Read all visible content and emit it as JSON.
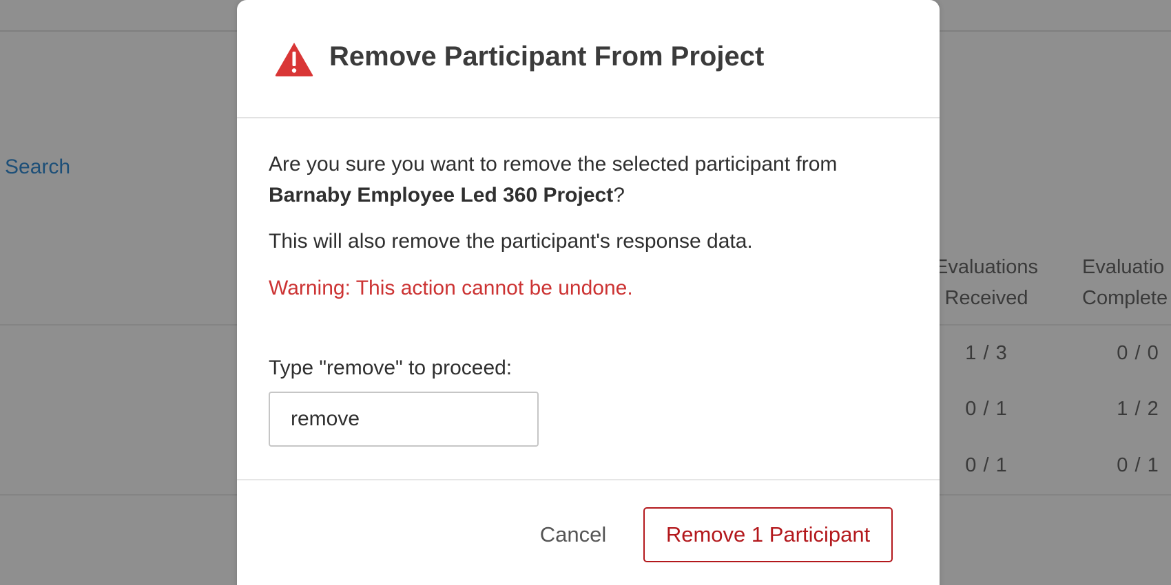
{
  "background": {
    "search_label": "Search",
    "columns": [
      {
        "header_line1": "Evaluations",
        "header_line2": "Received"
      },
      {
        "header_line1": "Evaluatio",
        "header_line2": "Complete"
      }
    ],
    "rows": [
      {
        "received": "1 / 3",
        "completed": "0 / 0"
      },
      {
        "received": "0 / 1",
        "completed": "1 / 2"
      },
      {
        "received": "0 / 1",
        "completed": "0 / 1"
      }
    ]
  },
  "dialog": {
    "icon": "warning-icon",
    "title": "Remove Participant From Project",
    "confirm_prefix": "Are you sure you want to remove the selected participant from",
    "project_name": "Barnaby Employee Led 360 Project",
    "confirm_suffix": "?",
    "data_notice": "This will also remove the participant's response data.",
    "warning": "Warning: This action cannot be undone.",
    "input_label": "Type \"remove\" to proceed:",
    "input_value": "remove",
    "cancel_label": "Cancel",
    "remove_label": "Remove 1 Participant",
    "colors": {
      "warning_text": "#cc3333",
      "danger_button": "#b3181c",
      "warning_icon": "#d93636"
    }
  }
}
